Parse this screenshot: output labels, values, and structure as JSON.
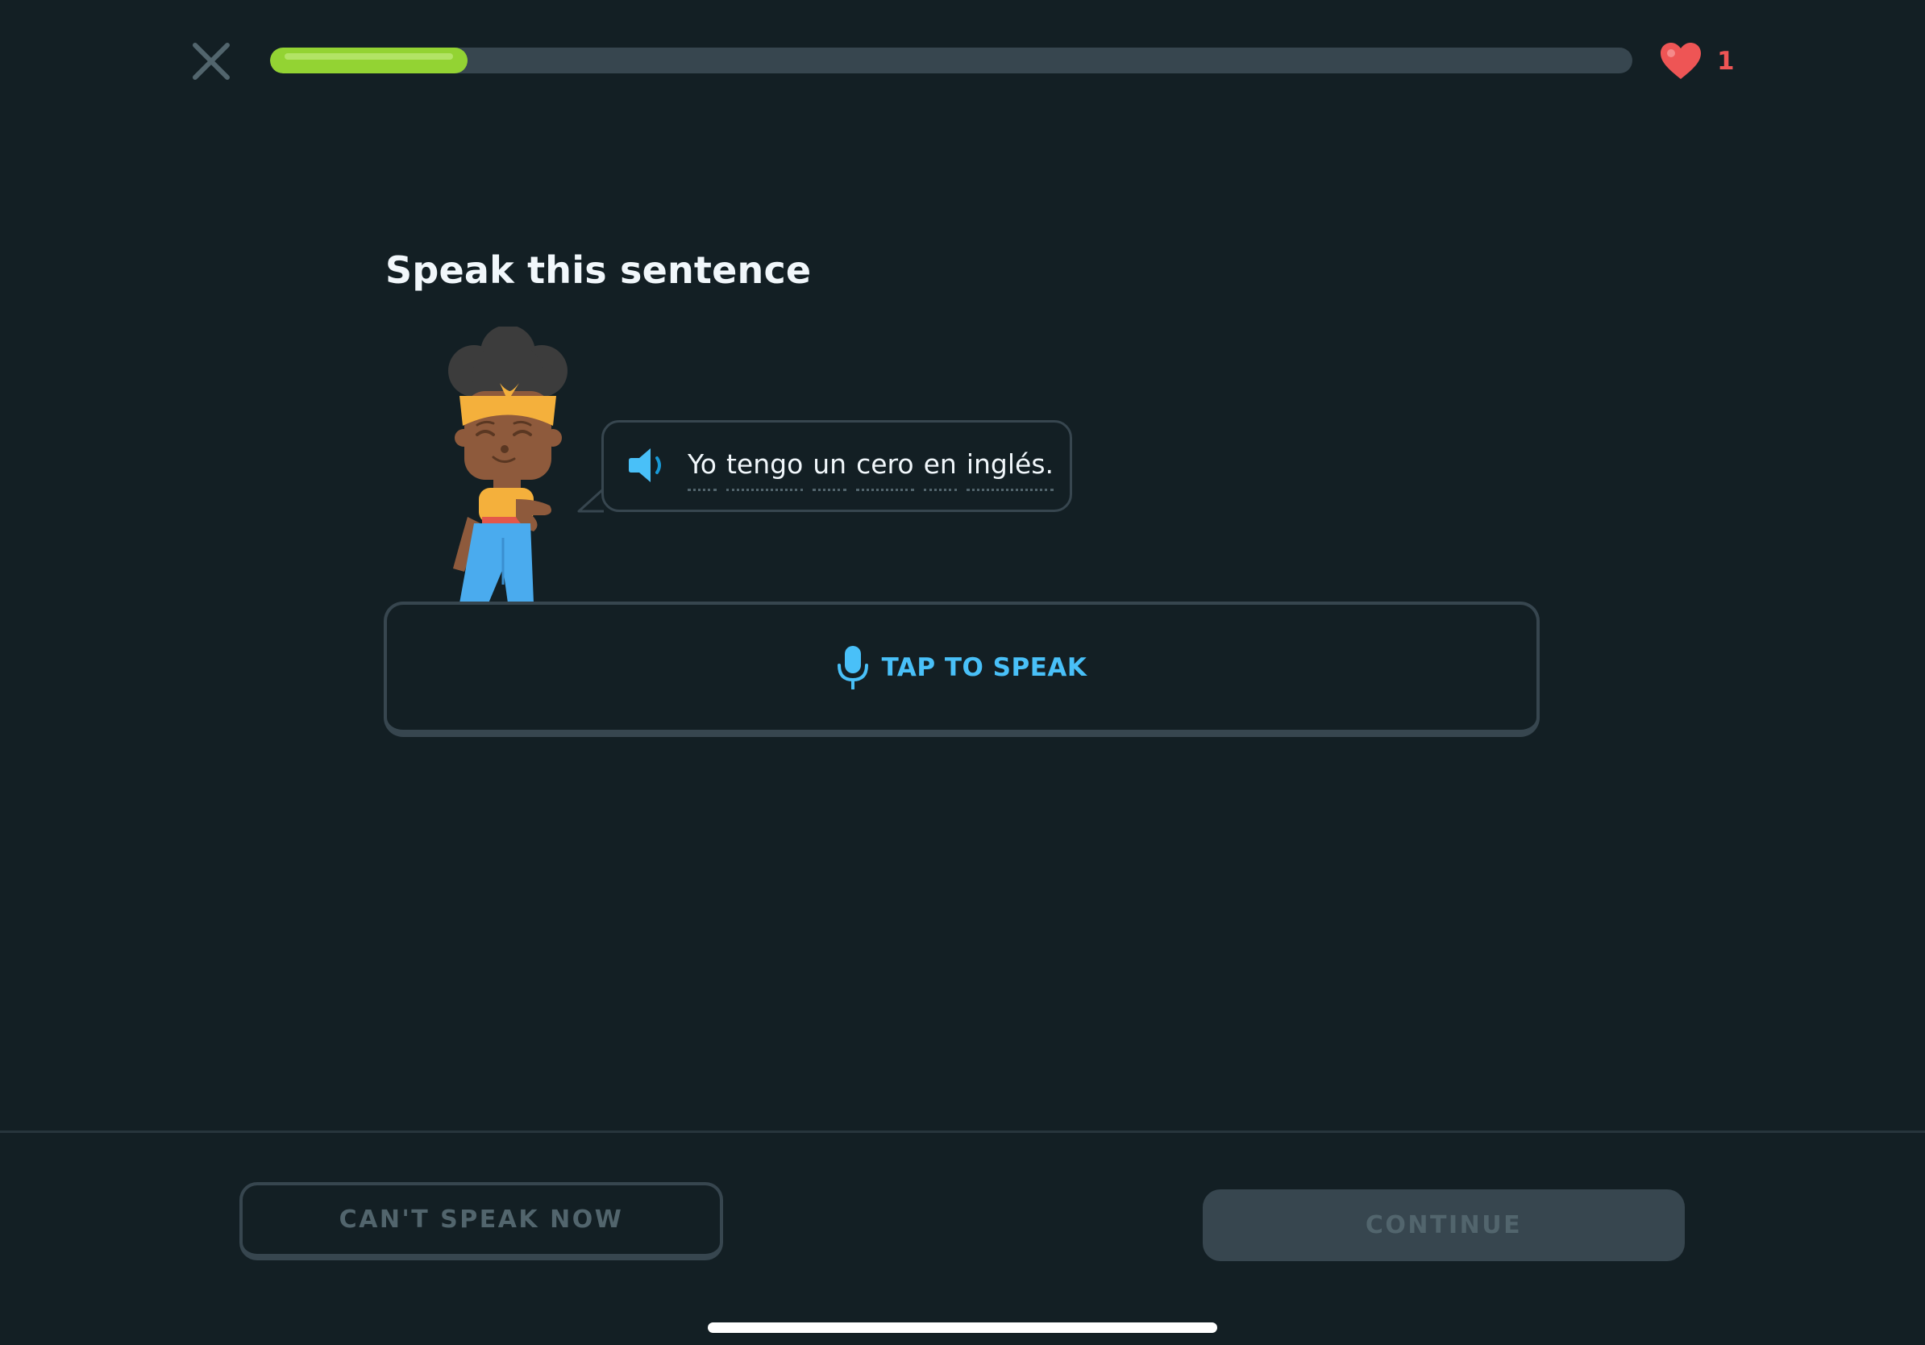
{
  "header": {
    "close_icon": "close-icon",
    "progress": 0.145,
    "hearts_count": "1",
    "colors": {
      "progress_fill": "#93d333",
      "progress_track": "#37464f",
      "heart": "#ee5555"
    }
  },
  "challenge": {
    "title": "Speak this sentence",
    "sentence_words": [
      "Yo",
      "tengo",
      "un",
      "cero",
      "en",
      "inglés."
    ],
    "speaker_icon": "speaker-icon",
    "tap_to_speak_label": "TAP TO SPEAK",
    "mic_icon": "microphone-icon",
    "accent_color": "#49c0f8"
  },
  "footer": {
    "cant_speak_label": "CAN'T SPEAK NOW",
    "continue_label": "CONTINUE",
    "continue_enabled": false
  },
  "theme": {
    "background": "#131f24",
    "border": "#37464f",
    "text": "#f1f7fb",
    "muted": "#52656d"
  }
}
